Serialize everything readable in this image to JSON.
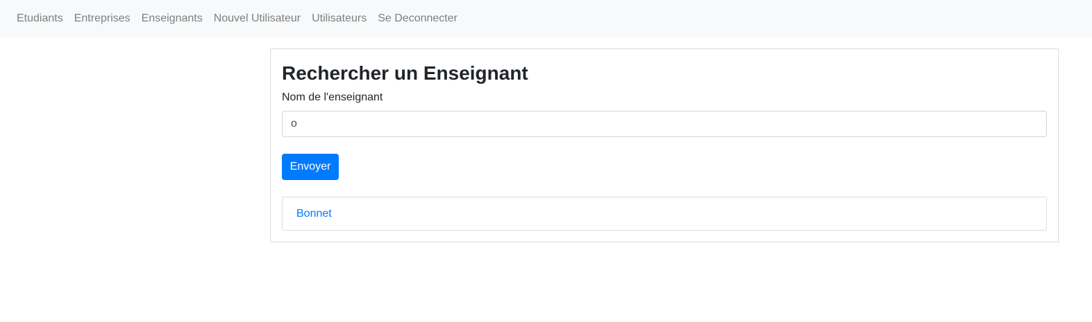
{
  "navbar": {
    "items": [
      {
        "label": "Etudiants"
      },
      {
        "label": "Entreprises"
      },
      {
        "label": "Enseignants"
      },
      {
        "label": "Nouvel Utilisateur"
      },
      {
        "label": "Utilisateurs"
      },
      {
        "label": "Se Deconnecter"
      }
    ]
  },
  "search": {
    "title": "Rechercher un Enseignant",
    "label": "Nom de l'enseignant",
    "value": "o",
    "submit_label": "Envoyer"
  },
  "results": [
    {
      "name": "Bonnet"
    }
  ],
  "colors": {
    "navbar_bg": "#f8f9fa",
    "primary": "#007bff",
    "nav_text": "#7f7f7f",
    "border": "#dcdcdc"
  }
}
